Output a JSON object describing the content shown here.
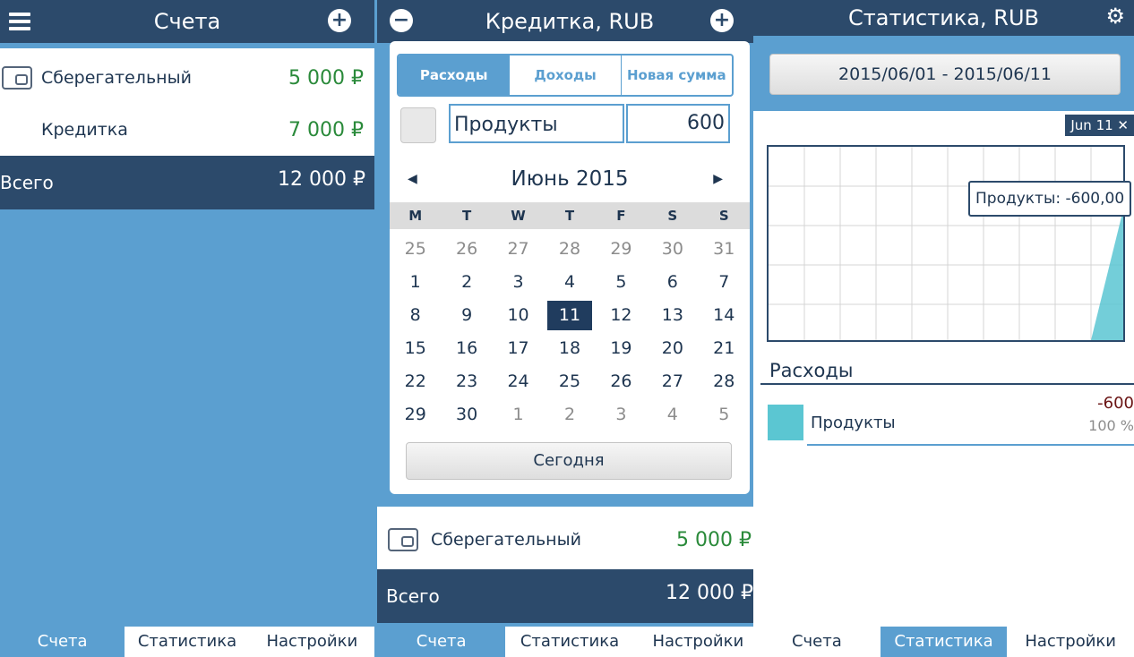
{
  "s1": {
    "title": "Счета",
    "accounts": [
      {
        "name": "Сберегательный",
        "amount": "5 000 ₽"
      },
      {
        "name": "Кредитка",
        "amount": "7 000 ₽"
      }
    ],
    "total_label": "Всего",
    "total_amount": "12 000 ₽",
    "tabs": [
      "Счета",
      "Статистика",
      "Настройки"
    ]
  },
  "s2": {
    "title": "Кредитка, RUB",
    "seg": [
      "Расходы",
      "Доходы",
      "Новая сумма"
    ],
    "category": "Продукты",
    "amount": "600",
    "month": "Июнь 2015",
    "weekdays": [
      "M",
      "T",
      "W",
      "T",
      "F",
      "S",
      "S"
    ],
    "today": "Сегодня",
    "account": {
      "name": "Сберегательный",
      "amount": "5 000 ₽"
    },
    "total_label": "Всего",
    "total_amount": "12 000 ₽",
    "tabs": [
      "Счета",
      "Статистика",
      "Настройки"
    ]
  },
  "s3": {
    "title": "Статистика, RUB",
    "range": "2015/06/01 - 2015/06/11",
    "date_tag": "Jun 11 ✕",
    "tooltip": "Продукты: -600,00",
    "section": "Расходы",
    "item": {
      "name": "Продукты",
      "value": "-600",
      "percent": "100 %",
      "color": "#5bc6d2"
    },
    "tabs": [
      "Счета",
      "Статистика",
      "Настройки"
    ]
  },
  "colors": {
    "header": "#2c4a6b",
    "accent": "#5b9fd0",
    "positive": "#2a8a3a",
    "negative": "#6a1414"
  }
}
